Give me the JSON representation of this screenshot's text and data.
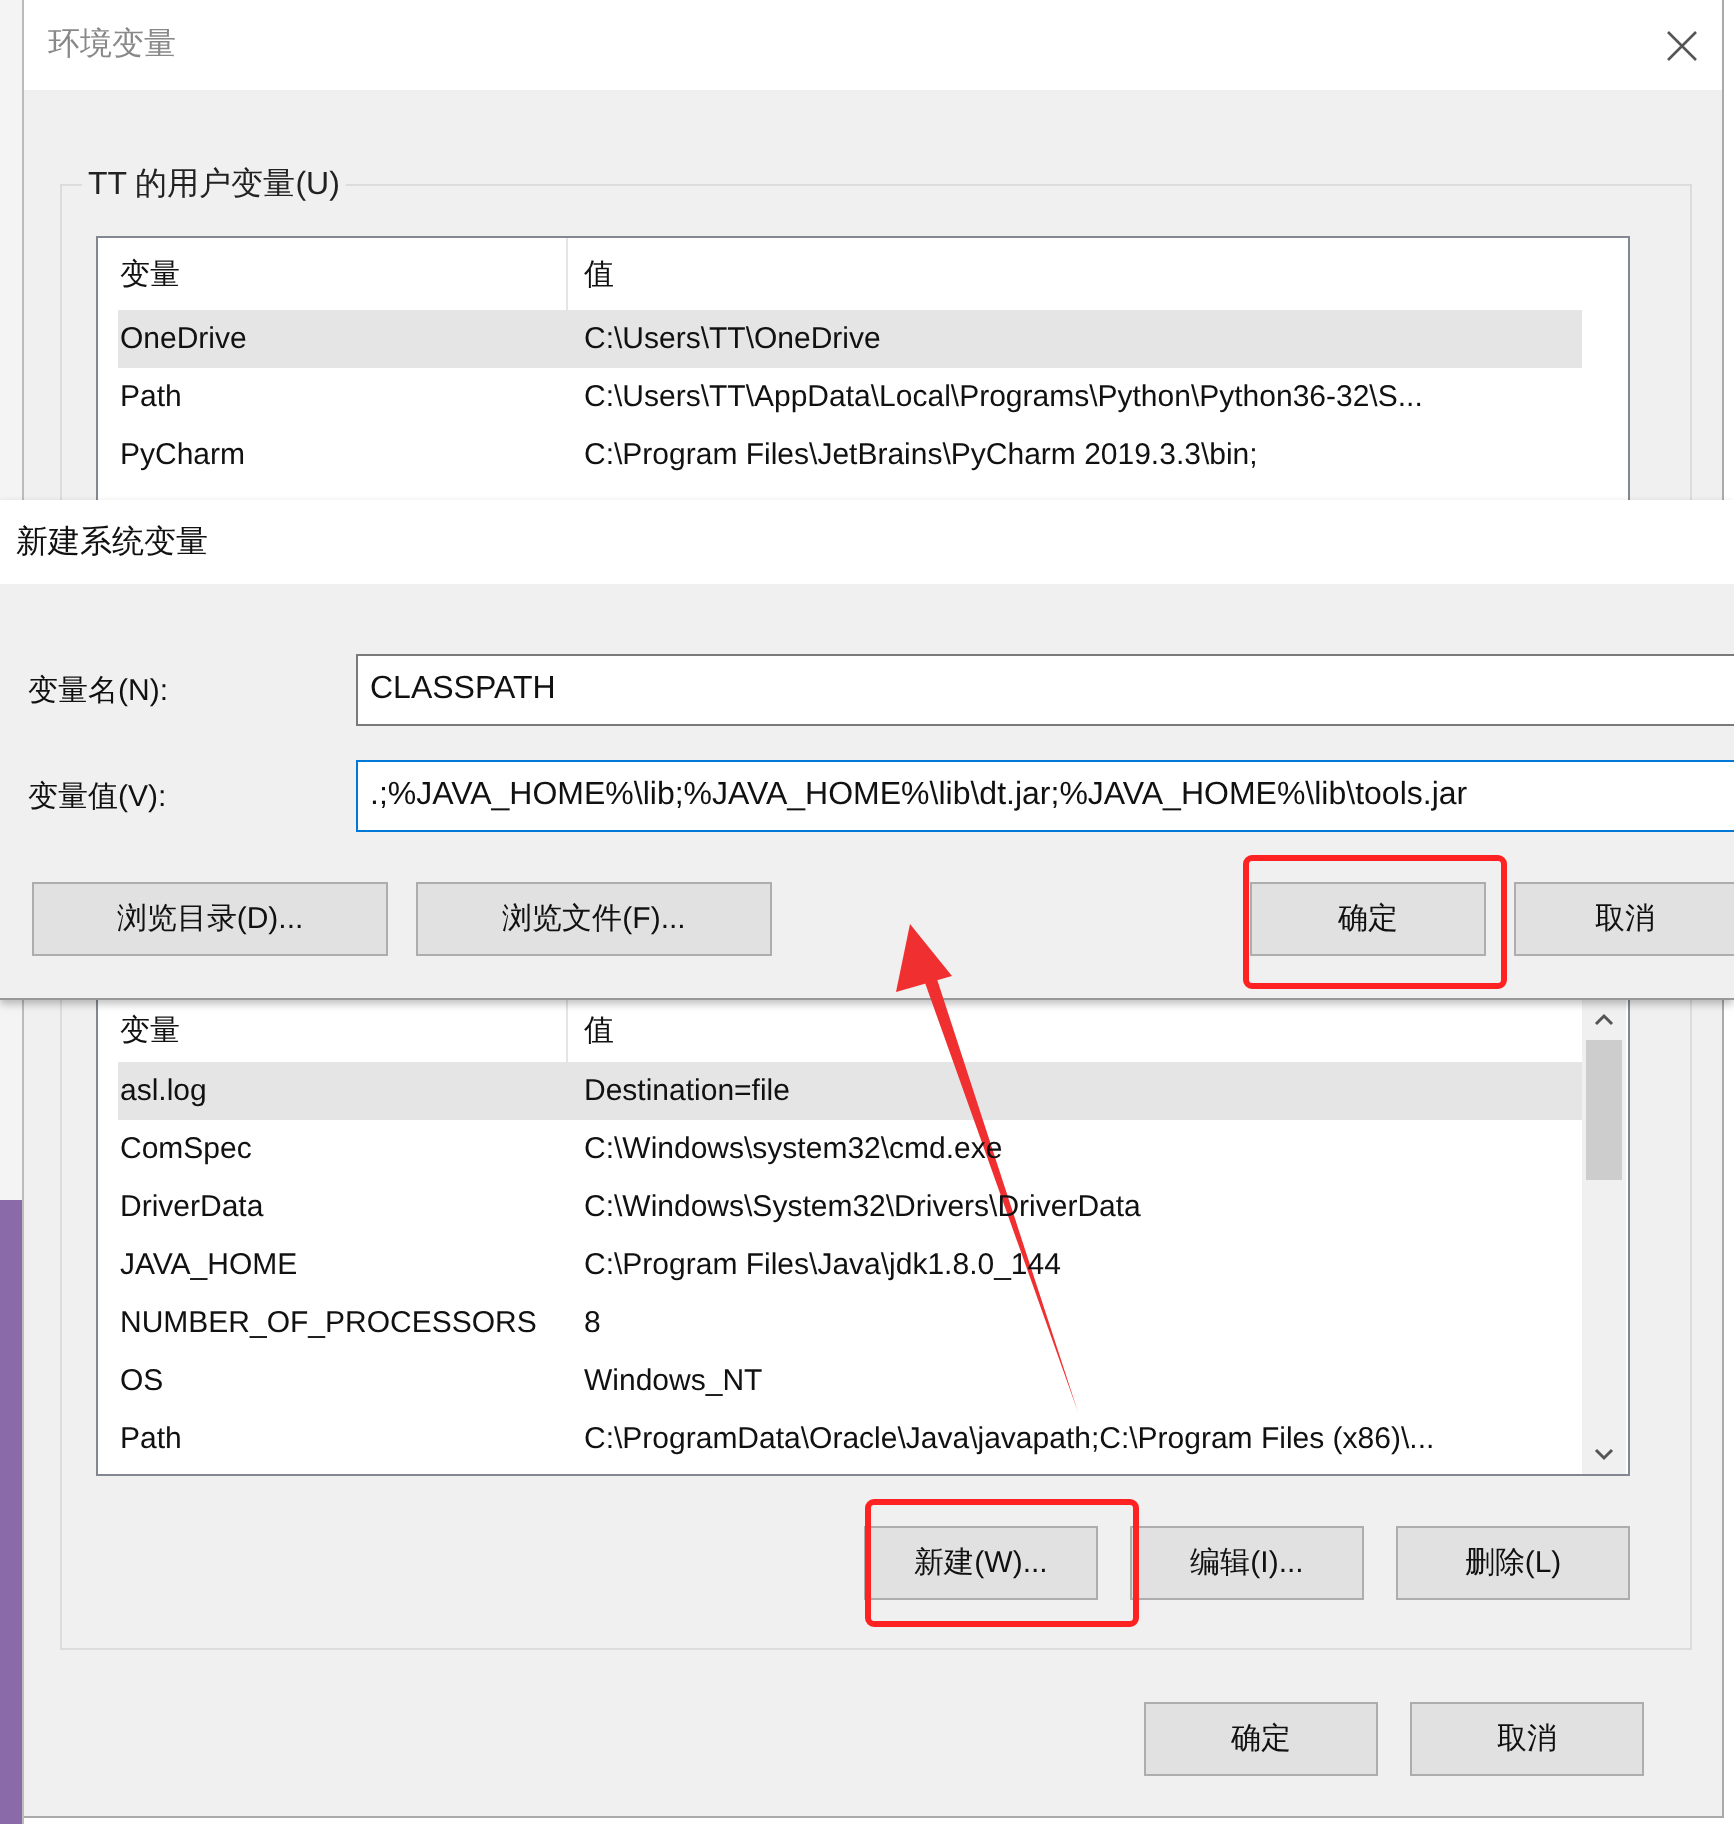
{
  "env_dialog": {
    "title": "环境变量",
    "user_vars": {
      "label": "TT 的用户变量(U)",
      "columns": [
        "变量",
        "值"
      ],
      "rows": [
        {
          "name": "OneDrive",
          "value": "C:\\Users\\TT\\OneDrive",
          "selected": true
        },
        {
          "name": "Path",
          "value": "C:\\Users\\TT\\AppData\\Local\\Programs\\Python\\Python36-32\\S...",
          "selected": false
        },
        {
          "name": "PyCharm",
          "value": "C:\\Program Files\\JetBrains\\PyCharm 2019.3.3\\bin;",
          "selected": false
        }
      ]
    },
    "system_vars": {
      "columns": [
        "变量",
        "值"
      ],
      "rows": [
        {
          "name": "asl.log",
          "value": "Destination=file",
          "selected": true
        },
        {
          "name": "ComSpec",
          "value": "C:\\Windows\\system32\\cmd.exe",
          "selected": false
        },
        {
          "name": "DriverData",
          "value": "C:\\Windows\\System32\\Drivers\\DriverData",
          "selected": false
        },
        {
          "name": "JAVA_HOME",
          "value": "C:\\Program Files\\Java\\jdk1.8.0_144",
          "selected": false
        },
        {
          "name": "NUMBER_OF_PROCESSORS",
          "value": "8",
          "selected": false
        },
        {
          "name": "OS",
          "value": "Windows_NT",
          "selected": false
        },
        {
          "name": "Path",
          "value": "C:\\ProgramData\\Oracle\\Java\\javapath;C:\\Program Files (x86)\\...",
          "selected": false
        }
      ],
      "buttons": [
        "新建(W)...",
        "编辑(I)...",
        "删除(L)"
      ]
    },
    "buttons": [
      "确定",
      "取消"
    ]
  },
  "new_var_dialog": {
    "title": "新建系统变量",
    "fields": [
      {
        "label": "变量名(N):",
        "value": "CLASSPATH",
        "focused": false
      },
      {
        "label": "变量值(V):",
        "value": ".;%JAVA_HOME%\\lib;%JAVA_HOME%\\lib\\dt.jar;%JAVA_HOME%\\lib\\tools.jar",
        "focused": true
      }
    ],
    "browse_buttons": [
      "浏览目录(D)...",
      "浏览文件(F)..."
    ],
    "buttons": [
      "确定",
      "取消"
    ]
  }
}
